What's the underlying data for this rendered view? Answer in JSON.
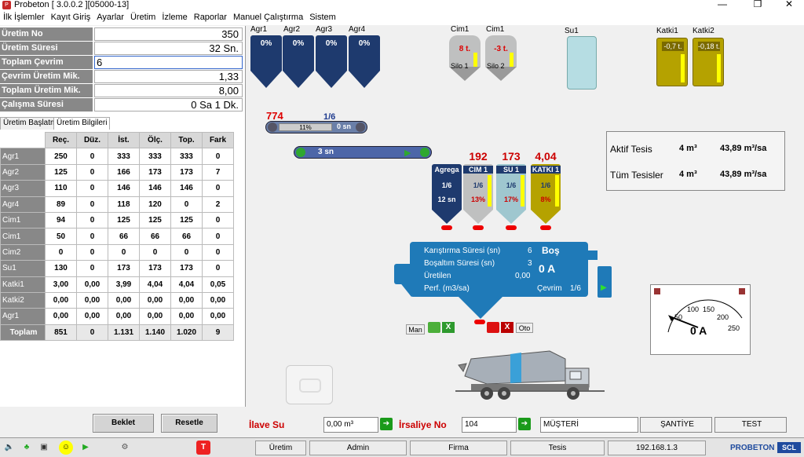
{
  "window": {
    "title": "Probeton [ 3.0.0.2 ][05000-13]",
    "minimize": "—",
    "maximize": "❐",
    "close": "✕"
  },
  "menu": [
    "İlk İşlemler",
    "Kayıt Giriş",
    "Ayarlar",
    "Üretim",
    "İzleme",
    "Raporlar",
    "Manuel Çalıştırma",
    "Sistem"
  ],
  "info": [
    {
      "label": "Üretim No",
      "value": "350"
    },
    {
      "label": "Üretim Süresi",
      "value": "32 Sn."
    },
    {
      "label": "Toplam Çevrim",
      "value": "6"
    },
    {
      "label": "Çevrim Üretim Mik.",
      "value": "1,33"
    },
    {
      "label": "Toplam Üretim Mik.",
      "value": "8,00"
    },
    {
      "label": "Çalışma Süresi",
      "value": "0 Sa 1 Dk."
    }
  ],
  "tabs": [
    "Üretim Başlatma",
    "Üretim Bilgileri"
  ],
  "grid": {
    "headers": [
      "Reç.",
      "Düz.",
      "İst.",
      "Ölç.",
      "Top.",
      "Fark"
    ],
    "rows": [
      {
        "name": "Agr1",
        "v": [
          "250",
          "0",
          "333",
          "333",
          "333",
          "0"
        ]
      },
      {
        "name": "Agr2",
        "v": [
          "125",
          "0",
          "166",
          "173",
          "173",
          "7"
        ]
      },
      {
        "name": "Agr3",
        "v": [
          "110",
          "0",
          "146",
          "146",
          "146",
          "0"
        ]
      },
      {
        "name": "Agr4",
        "v": [
          "89",
          "0",
          "118",
          "120",
          "0",
          "2"
        ]
      },
      {
        "name": "Cim1",
        "v": [
          "94",
          "0",
          "125",
          "125",
          "125",
          "0"
        ]
      },
      {
        "name": "Cim1",
        "v": [
          "50",
          "0",
          "66",
          "66",
          "66",
          "0"
        ]
      },
      {
        "name": "Cim2",
        "v": [
          "0",
          "0",
          "0",
          "0",
          "0",
          "0"
        ]
      },
      {
        "name": "Su1",
        "v": [
          "130",
          "0",
          "173",
          "173",
          "173",
          "0"
        ]
      },
      {
        "name": "Katki1",
        "v": [
          "3,00",
          "0,00",
          "3,99",
          "4,04",
          "4,04",
          "0,05"
        ]
      },
      {
        "name": "Katki2",
        "v": [
          "0,00",
          "0,00",
          "0,00",
          "0,00",
          "0,00",
          "0,00"
        ]
      },
      {
        "name": "Agr1",
        "v": [
          "0,00",
          "0,00",
          "0,00",
          "0,00",
          "0,00",
          "0,00"
        ]
      }
    ],
    "total": {
      "name": "Toplam",
      "v": [
        "851",
        "0",
        "1.131",
        "1.140",
        "1.020",
        "9"
      ]
    }
  },
  "buttons": {
    "beklet": "Beklet",
    "resetle": "Resetle"
  },
  "aggregates": [
    {
      "label": "Agr1",
      "value": "0%"
    },
    {
      "label": "Agr2",
      "value": "0%"
    },
    {
      "label": "Agr3",
      "value": "0%"
    },
    {
      "label": "Agr4",
      "value": "0%"
    }
  ],
  "silos": [
    {
      "label": "Cim1",
      "value": "8 t.",
      "tag": "Silo 1"
    },
    {
      "label": "Cim1",
      "value": "-3 t.",
      "tag": "Silo 2"
    }
  ],
  "su": {
    "label": "Su1"
  },
  "katki": [
    {
      "label": "Katki1",
      "value": "-0,7 t."
    },
    {
      "label": "Katki2",
      "value": "-0,18 t."
    }
  ],
  "conveyor1": {
    "top_value": "774",
    "cycle": "1/6",
    "percent": "11%",
    "time": "0 sn"
  },
  "conveyor2": {
    "time": "3 sn"
  },
  "weighers": [
    {
      "top": "",
      "label": "Agrega",
      "cycle": "1/6",
      "sub": "12 sn",
      "color": "#1e3a6e"
    },
    {
      "top": "192",
      "label": "CIM 1",
      "cycle": "1/6",
      "sub": "13%",
      "color": "#bfc0c0"
    },
    {
      "top": "173",
      "label": "SU 1",
      "cycle": "1/6",
      "sub": "17%",
      "color": "#9fc7cf"
    },
    {
      "top": "4,04",
      "label": "KATKI 1",
      "cycle": "1/6",
      "sub": "8%",
      "color": "#b5a200"
    }
  ],
  "tesis": [
    {
      "label": "Aktif Tesis",
      "m3": "4 m³",
      "rate": "43,89 m³/sa"
    },
    {
      "label": "Tüm Tesisler",
      "m3": "4 m³",
      "rate": "43,89 m³/sa"
    }
  ],
  "mixer": {
    "rows": [
      {
        "label": "Karıştırma Süresi (sn)",
        "value": "6"
      },
      {
        "label": "Boşaltım Süresi (sn)",
        "value": "3"
      },
      {
        "label": "Üretilen",
        "value": "0,00"
      },
      {
        "label": "Perf. (m3/sa)",
        "value": ""
      }
    ],
    "state": "Boş",
    "amp": "0 A",
    "cevrim_label": "Çevrim",
    "cevrim": "1/6"
  },
  "mixer_controls": {
    "man": "Man",
    "oto": "Oto",
    "ok": "✓",
    "x": "X"
  },
  "gauge": {
    "ticks": [
      "50",
      "100",
      "150",
      "200",
      "250"
    ],
    "value": "0 A"
  },
  "bottom": {
    "ilave_label": "İlave Su",
    "ilave_value": "0,00 m³",
    "irsaliye_label": "İrsaliye No",
    "irsaliye_value": "104",
    "musteri": "MÜŞTERİ",
    "santiye": "ŞANTİYE",
    "test": "TEST"
  },
  "status": {
    "uretim": "Üretim",
    "admin": "Admin",
    "firma": "Firma",
    "tesis": "Tesis",
    "ip": "192.168.1.3",
    "logo": "PROBETON",
    "logo2": "SCL"
  }
}
